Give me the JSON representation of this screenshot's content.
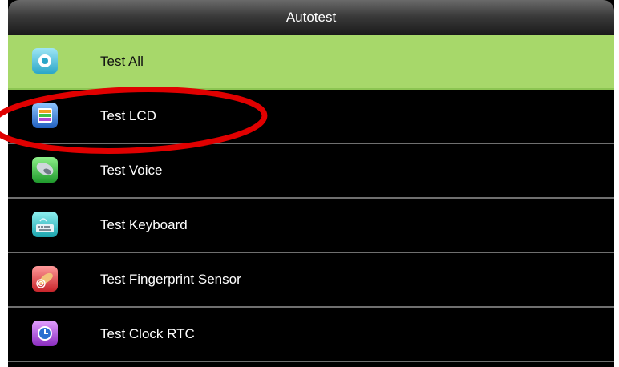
{
  "header": {
    "title": "Autotest"
  },
  "menu": {
    "items": [
      {
        "label": "Test All",
        "icon": "test-all-icon",
        "selected": true
      },
      {
        "label": "Test LCD",
        "icon": "lcd-icon",
        "selected": false
      },
      {
        "label": "Test Voice",
        "icon": "speaker-icon",
        "selected": false
      },
      {
        "label": "Test Keyboard",
        "icon": "keyboard-icon",
        "selected": false
      },
      {
        "label": "Test Fingerprint Sensor",
        "icon": "fingerprint-icon",
        "selected": false
      },
      {
        "label": "Test Clock RTC",
        "icon": "clock-icon",
        "selected": false
      }
    ]
  },
  "colors": {
    "selected_row": "#a7d86a",
    "annotation": "#e00000"
  }
}
